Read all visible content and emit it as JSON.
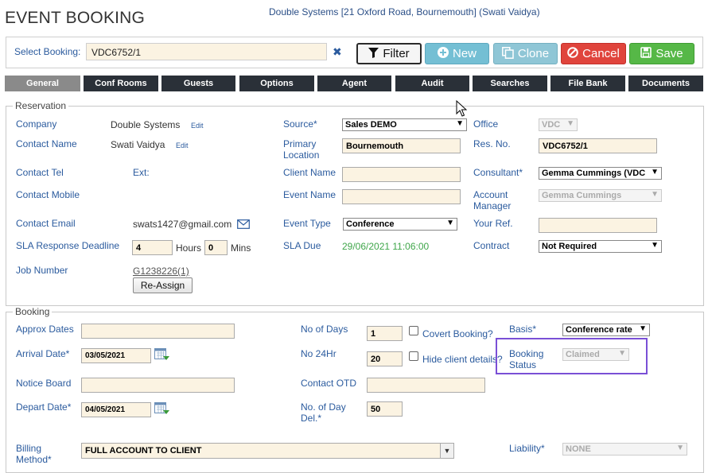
{
  "app_title": "EVENT BOOKING",
  "company_header": "Double Systems [21 Oxford Road, Bournemouth] (Swati Vaidya)",
  "toolbar": {
    "select_label": "Select Booking:",
    "booking_value": "VDC6752/1",
    "clear_icon": "close-icon",
    "filter_label": "Filter",
    "new_label": "New",
    "clone_label": "Clone",
    "cancel_label": "Cancel",
    "save_label": "Save"
  },
  "tabs": [
    "General",
    "Conf Rooms",
    "Guests",
    "Options",
    "Agent",
    "Audit",
    "Searches",
    "File Bank",
    "Documents"
  ],
  "reservation": {
    "legend": "Reservation",
    "company_label": "Company",
    "company_value": "Double Systems",
    "edit_label": "Edit",
    "contact_name_label": "Contact Name",
    "contact_name_value": "Swati Vaidya",
    "contact_tel_label": "Contact Tel",
    "ext_label": "Ext:",
    "contact_mobile_label": "Contact Mobile",
    "contact_email_label": "Contact Email",
    "contact_email_value": "swats1427@gmail.com",
    "sla_label": "SLA Response Deadline",
    "sla_hours": "4",
    "hours_label": "Hours",
    "sla_mins": "0",
    "mins_label": "Mins",
    "job_number_label": "Job Number",
    "job_number_value": "G1238226(1)",
    "reassign_label": "Re-Assign",
    "source_label": "Source*",
    "source_value": "Sales DEMO",
    "primary_location_label_1": "Primary",
    "primary_location_label_2": "Location",
    "primary_location_value": "Bournemouth",
    "client_name_label": "Client Name",
    "event_name_label": "Event Name",
    "event_type_label": "Event Type",
    "event_type_value": "Conference",
    "sla_due_label": "SLA Due",
    "sla_due_value": "29/06/2021 11:06:00",
    "office_label": "Office",
    "office_value": "VDC",
    "res_no_label": "Res. No.",
    "res_no_value": "VDC6752/1",
    "consultant_label": "Consultant*",
    "consultant_value": "Gemma Cummings (VDC",
    "account_manager_label_1": "Account",
    "account_manager_label_2": "Manager",
    "account_manager_value": "Gemma Cummings",
    "your_ref_label": "Your Ref.",
    "contract_label": "Contract",
    "contract_value": "Not Required"
  },
  "booking": {
    "legend": "Booking",
    "approx_dates_label": "Approx Dates",
    "arrival_date_label": "Arrival Date*",
    "arrival_date_value": "03/05/2021",
    "notice_board_label": "Notice Board",
    "depart_date_label": "Depart Date*",
    "depart_date_value": "04/05/2021",
    "billing_method_label_1": "Billing",
    "billing_method_label_2": "Method*",
    "billing_method_value": "FULL ACCOUNT TO CLIENT",
    "no_of_days_label": "No of Days",
    "no_of_days_value": "1",
    "covert_booking_label": "Covert Booking?",
    "no_24hr_label": "No 24Hr",
    "no_24hr_value": "20",
    "hide_client_label": "Hide client details?",
    "contact_otd_label": "Contact OTD",
    "no_day_del_label_1": "No. of Day",
    "no_day_del_label_2": "Del.*",
    "no_day_del_value": "50",
    "basis_label": "Basis*",
    "basis_value": "Conference rate",
    "booking_status_label_1": "Booking",
    "booking_status_label_2": "Status",
    "booking_status_value": "Claimed",
    "liability_label": "Liability*",
    "liability_value": "NONE"
  },
  "colors": {
    "label_blue": "#2b5b9e",
    "input_bg": "#fbf3e2",
    "tab_dark": "#2a3038",
    "tab_active": "#8a8a8a",
    "new_btn": "#74bfd4",
    "clone_btn": "#8fc6d6",
    "cancel_btn": "#e0443c",
    "save_btn": "#56b847",
    "sla_due_green": "#3fa64a",
    "highlight_purple": "#7a4fd6"
  }
}
